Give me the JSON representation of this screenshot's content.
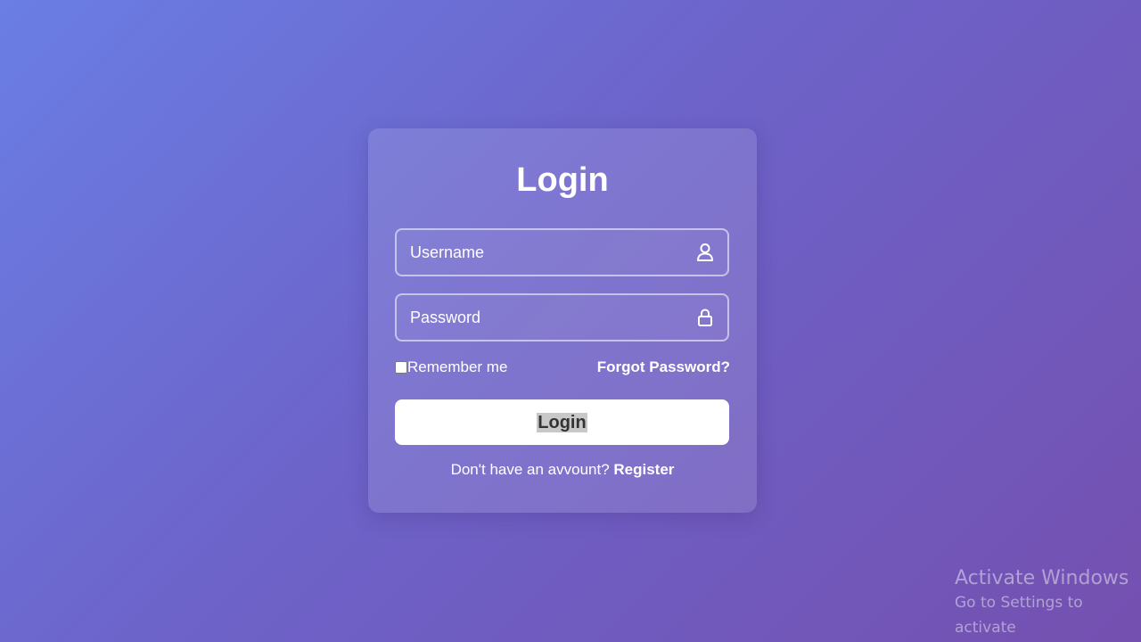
{
  "login": {
    "title": "Login",
    "username": {
      "placeholder": "Username",
      "icon": "user-icon"
    },
    "password": {
      "placeholder": "Password",
      "icon": "lock-icon"
    },
    "remember_label": "Remember me",
    "forgot_label": "Forgot Password?",
    "button_label": "Login",
    "register_prompt": "Don't have an avvount?",
    "register_link": "Register"
  },
  "watermark": {
    "line1": "Activate Windows",
    "line2": "Go to Settings to activate"
  },
  "colors": {
    "gradient_start": "#6a7ee4",
    "gradient_end": "#7450b0",
    "text": "#ffffff",
    "button_bg": "#ffffff",
    "button_text": "#333333"
  }
}
